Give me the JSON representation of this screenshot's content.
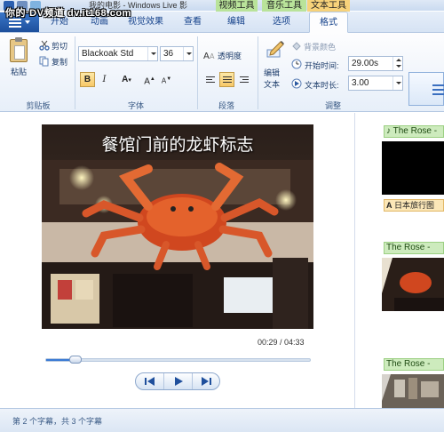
{
  "title_bar": {
    "watermark": "你的·DV频道 dv.it168.com",
    "window_title": "我的电影 - Windows Live 影"
  },
  "context_tabs": {
    "video_tools": "视频工具",
    "music_tools": "音乐工具",
    "text_tools": "文本工具"
  },
  "tabs": [
    "开始",
    "动画",
    "视觉效果",
    "查看",
    "编辑",
    "选项",
    "格式"
  ],
  "active_tab": "格式",
  "ribbon": {
    "clipboard": {
      "label": "剪贴板",
      "paste": "粘贴",
      "cut": "剪切",
      "copy": "复制"
    },
    "font": {
      "label": "字体",
      "family": "Blackoak Std",
      "size": "36"
    },
    "paragraph": {
      "label": "段落",
      "transparency": "透明度"
    },
    "adjust": {
      "label": "调整",
      "edit_text": "编辑\n文本",
      "edit_text_line1": "编辑",
      "edit_text_line2": "文本",
      "bg_color": "背景颜色",
      "start_time_label": "开始时间:",
      "start_time_value": "29.00s",
      "duration_label": "文本时长:",
      "duration_value": "3.00"
    }
  },
  "preview": {
    "caption": "餐馆门前的龙虾标志",
    "time": "00:29 / 04:33",
    "seek_progress": 0.11
  },
  "storyboard": {
    "music_label_1": "The Rose -",
    "text_caption": "日本旅行图",
    "music_label_2": "The Rose -",
    "music_label_3": "The Rose -"
  },
  "status": {
    "text": "第 2 个字幕，共 3 个字幕"
  },
  "colors": {
    "accent_blue": "#1d4f9c",
    "music_green": "#cdebbd",
    "text_orange": "#fbe7b8",
    "context_text_tab": "#f7d27a"
  }
}
